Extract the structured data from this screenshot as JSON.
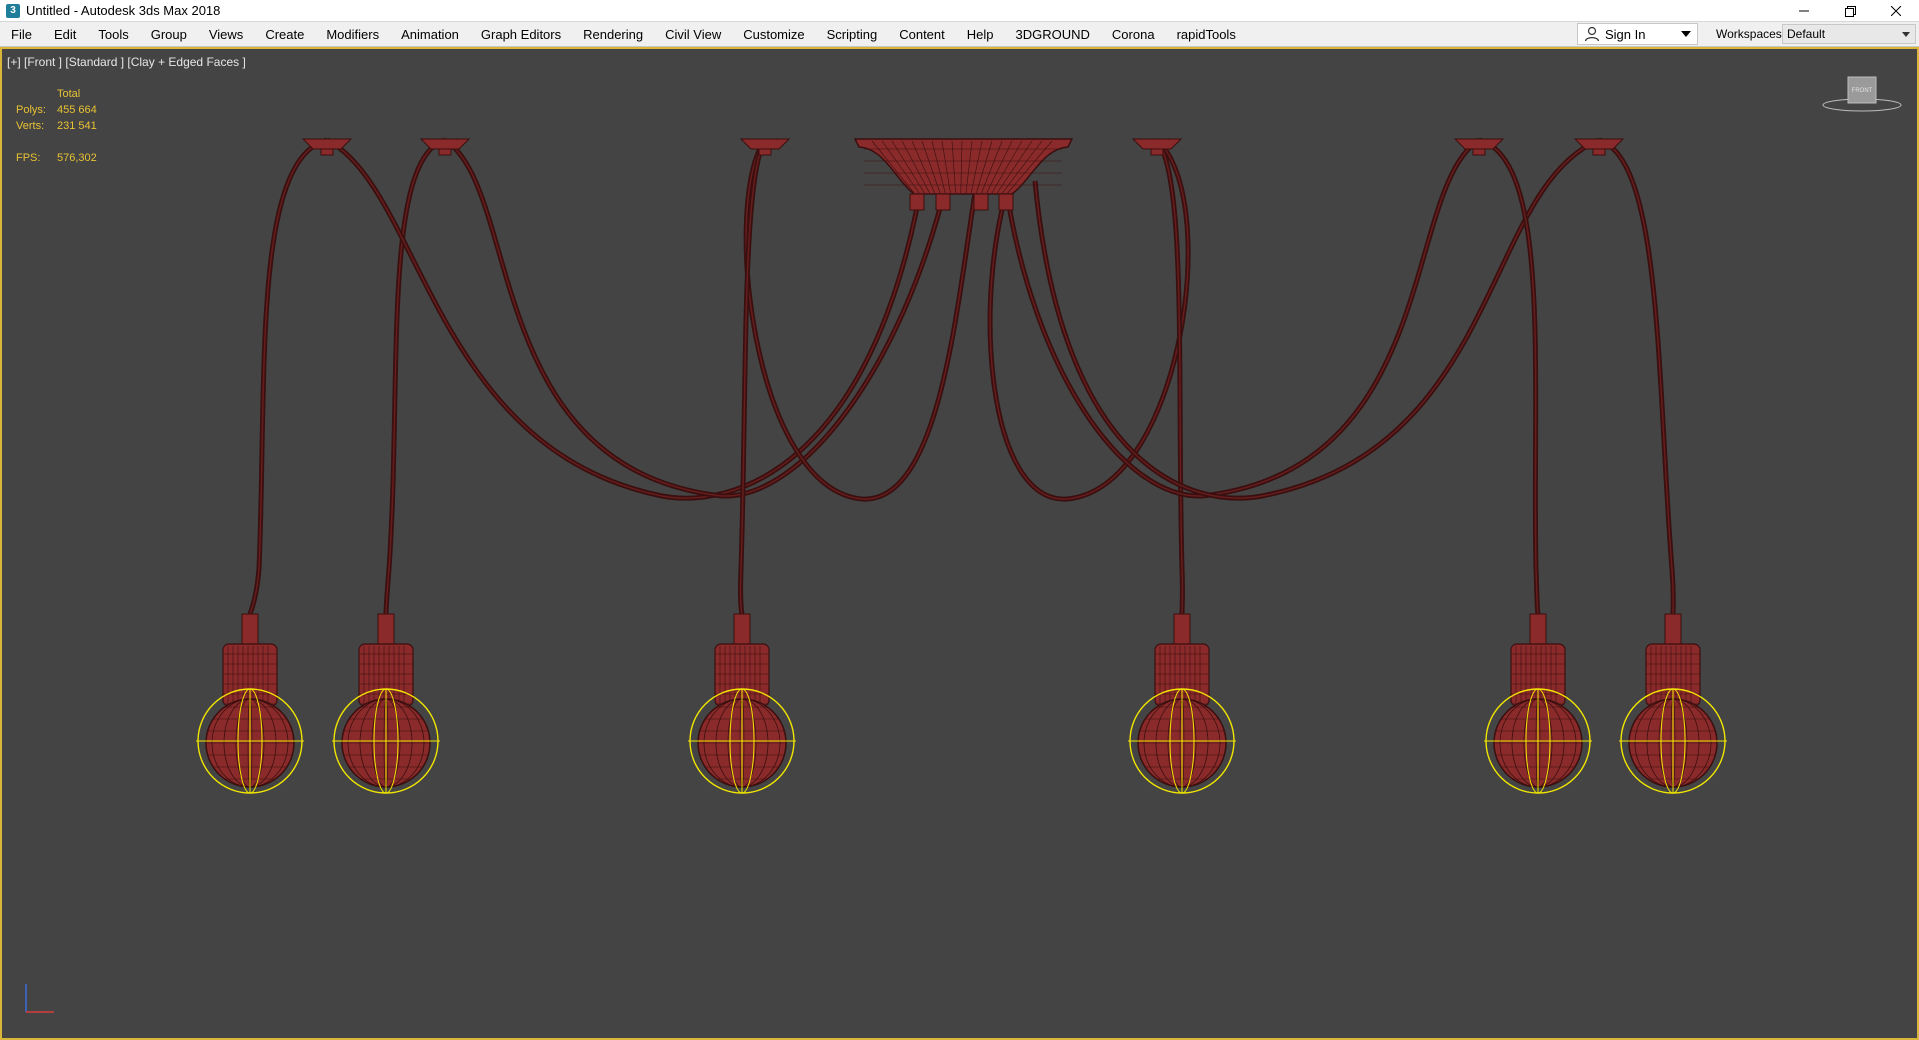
{
  "window": {
    "app_icon": "3dsmax-icon",
    "title": "Untitled - Autodesk 3ds Max 2018",
    "controls": [
      "minimize-icon",
      "restore-icon",
      "close-icon"
    ]
  },
  "menu": {
    "items": [
      "File",
      "Edit",
      "Tools",
      "Group",
      "Views",
      "Create",
      "Modifiers",
      "Animation",
      "Graph Editors",
      "Rendering",
      "Civil View",
      "Customize",
      "Scripting",
      "Content",
      "Help",
      "3DGROUND",
      "Corona",
      "rapidTools"
    ],
    "sign_in": "Sign In",
    "workspaces_label": "Workspaces:",
    "workspace_value": "Default"
  },
  "viewport": {
    "label": "[+] [Front ] [Standard ] [Clay + Edged Faces ]",
    "stats": {
      "header": "Total",
      "polys_label": "Polys:",
      "polys_value": "455 664",
      "verts_label": "Verts:",
      "verts_value": "231 541",
      "fps_label": "FPS:",
      "fps_value": "576,302"
    },
    "viewcube_face": "FRONT",
    "colors": {
      "background": "#444444",
      "mesh": "#8a2a2a",
      "wire": "#3a0f0f",
      "selection": "#f2e600",
      "border": "#d7b63a"
    }
  }
}
